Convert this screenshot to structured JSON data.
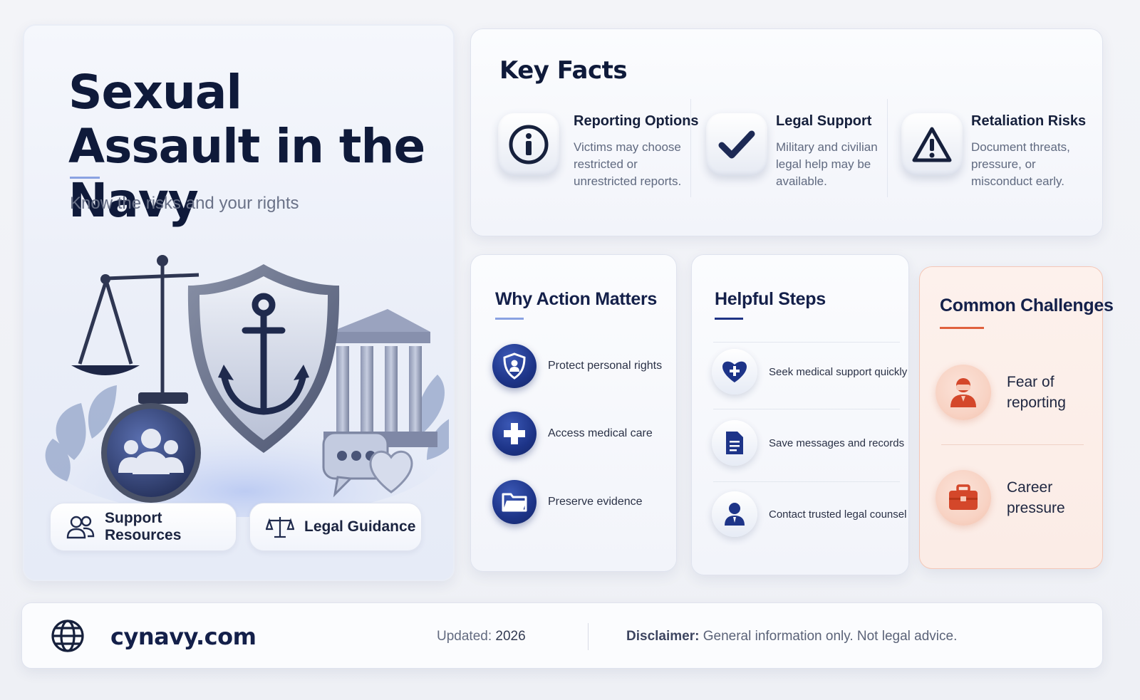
{
  "hero": {
    "title": "Sexual Assault in the Navy",
    "subtitle": "Know the risks and your rights",
    "chips": [
      {
        "label": "Support Resources",
        "icon": "people-icon"
      },
      {
        "label": "Legal Guidance",
        "icon": "scales-icon"
      }
    ]
  },
  "key_facts": {
    "title": "Key Facts",
    "items": [
      {
        "heading": "Reporting Options",
        "body": "Victims may choose restricted or unrestricted reports.",
        "icon": "info-icon"
      },
      {
        "heading": "Legal Support",
        "body": "Military and civilian legal help may be available.",
        "icon": "checkmark-icon"
      },
      {
        "heading": "Retaliation Risks",
        "body": "Document threats, pressure, or misconduct early.",
        "icon": "warning-icon"
      }
    ]
  },
  "why": {
    "title": "Why Action Matters",
    "items": [
      {
        "label": "Protect personal rights",
        "icon": "shield-person-icon"
      },
      {
        "label": "Access medical care",
        "icon": "medical-cross-icon"
      },
      {
        "label": "Preserve evidence",
        "icon": "folder-icon"
      }
    ]
  },
  "steps": {
    "title": "Helpful Steps",
    "items": [
      {
        "label": "Seek medical support quickly",
        "icon": "heart-plus-icon"
      },
      {
        "label": "Save messages and records",
        "icon": "document-icon"
      },
      {
        "label": "Contact trusted legal counsel",
        "icon": "person-icon"
      }
    ]
  },
  "challenges": {
    "title": "Common Challenges",
    "items": [
      {
        "label": "Fear of reporting",
        "icon": "masked-person-icon"
      },
      {
        "label": "Career pressure",
        "icon": "briefcase-icon"
      }
    ]
  },
  "footer": {
    "site": "cynavy.com",
    "updated_label": "Updated:",
    "updated_value": "2026",
    "disclaimer_label": "Disclaimer:",
    "disclaimer_text": "General information only. Not legal advice."
  },
  "colors": {
    "navy": "#1d3488",
    "accent_orange": "#e0613d",
    "text_dark": "#0f1a3a"
  }
}
